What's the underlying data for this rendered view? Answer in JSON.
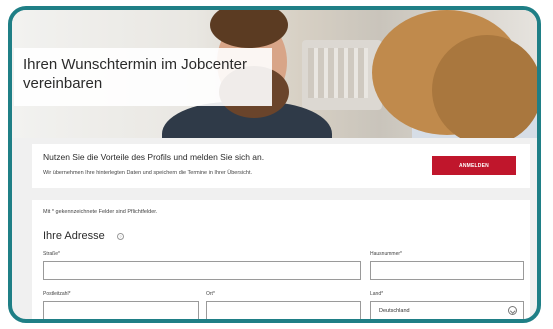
{
  "hero": {
    "title": "Ihren Wunschtermin im Jobcenter vereinbaren"
  },
  "login_panel": {
    "headline": "Nutzen Sie die Vorteile des Profils und melden Sie sich an.",
    "subtext": "Wir übernehmen Ihre hinterlegten Daten und speichern die Termine in Ihrer Übersicht.",
    "button_label": "ANMELDEN"
  },
  "form": {
    "required_note": "Mit * gekennzeichnete Felder sind Pflichtfelder.",
    "section_title": "Ihre Adresse",
    "fields": {
      "street": {
        "label": "Straße*",
        "value": ""
      },
      "house_number": {
        "label": "Hausnummer*",
        "value": ""
      },
      "postal_code": {
        "label": "Postleitzahl*",
        "value": ""
      },
      "city": {
        "label": "Ort*",
        "value": ""
      },
      "country": {
        "label": "Land*",
        "value": "Deutschland"
      }
    }
  },
  "colors": {
    "frame": "#1f7f86",
    "primary_button": "#c0162c"
  }
}
